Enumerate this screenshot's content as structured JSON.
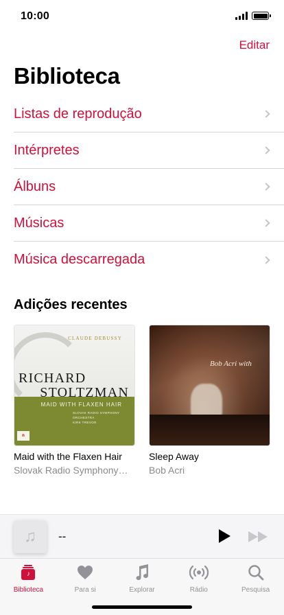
{
  "status_bar": {
    "time": "10:00"
  },
  "header": {
    "edit_label": "Editar",
    "title": "Biblioteca"
  },
  "library_items": [
    {
      "label": "Listas de reprodução"
    },
    {
      "label": "Intérpretes"
    },
    {
      "label": "Álbuns"
    },
    {
      "label": "Músicas"
    },
    {
      "label": "Música descarregada"
    }
  ],
  "recent": {
    "title": "Adições recentes",
    "albums": [
      {
        "name": "Maid with the Flaxen Hair",
        "artist": "Slovak Radio Symphony…",
        "cover": {
          "composer": "CLAUDE DEBUSSY",
          "line1": "RICHARD",
          "line2": "STOLTZMAN",
          "subtitle": "MAID WITH FLAXEN HAIR",
          "orchestra": "SLOVAK RADIO SYMPHONY ORCHESTRA",
          "conductor": "KIRK TREVOR"
        }
      },
      {
        "name": "Sleep Away",
        "artist": "Bob Acri",
        "cover": {
          "title": "Bob Acri with"
        }
      }
    ]
  },
  "mini_player": {
    "title": "--",
    "art_icon": "music-note-icon"
  },
  "tabs": [
    {
      "label": "Biblioteca",
      "icon": "library-icon",
      "active": true
    },
    {
      "label": "Para si",
      "icon": "heart-icon",
      "active": false
    },
    {
      "label": "Explorar",
      "icon": "music-note-icon",
      "active": false
    },
    {
      "label": "Rádio",
      "icon": "radio-icon",
      "active": false
    },
    {
      "label": "Pesquisa",
      "icon": "search-icon",
      "active": false
    }
  ],
  "colors": {
    "accent": "#d0103a",
    "secondary_text": "#8a8a8e",
    "inactive_tab": "#929298"
  }
}
